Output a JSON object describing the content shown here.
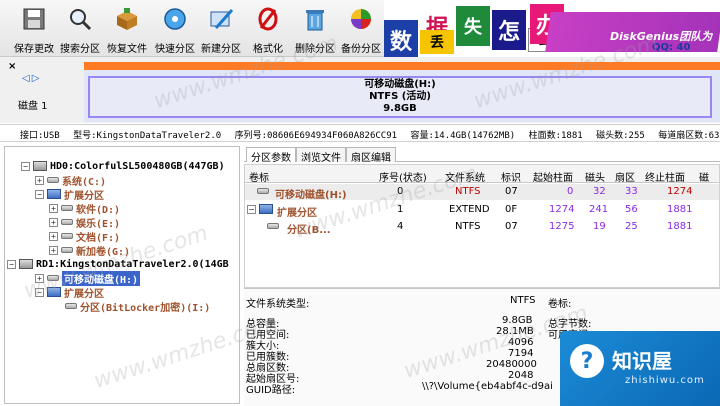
{
  "toolbar": {
    "buttons": [
      {
        "label": "保存更改",
        "icon": "save-icon"
      },
      {
        "label": "搜索分区",
        "icon": "magnifier-icon"
      },
      {
        "label": "恢复文件",
        "icon": "box-icon"
      },
      {
        "label": "快速分区",
        "icon": "quick-partition-icon"
      },
      {
        "label": "新建分区",
        "icon": "new-partition-icon"
      },
      {
        "label": "格式化",
        "icon": "format-icon"
      },
      {
        "label": "删除分区",
        "icon": "trash-icon"
      },
      {
        "label": "备份分区",
        "icon": "pie-backup-icon"
      }
    ]
  },
  "banner": {
    "tiles": [
      "数",
      "据",
      "丢",
      "失",
      "怎",
      "么",
      "办"
    ],
    "brand": "DiskGenius团队为",
    "qq": "QQ: 40"
  },
  "diskbar": {
    "close": "×",
    "arrows": "◁▷",
    "disk_label": "磁盘 1",
    "partition_name": "可移动磁盘(H:)",
    "partition_fs": "NTFS (活动)",
    "partition_size": "9.8GB"
  },
  "infoline": {
    "iface": "接口:USB",
    "model": "型号:KingstonDataTraveler2.0",
    "serial": "序列号:08606E694934F060A826CC91",
    "capacity": "容量:14.4GB(14762MB)",
    "cyl": "柱面数:1881",
    "heads": "磁头数:255",
    "sectors": "每道扇区数:63"
  },
  "tree": {
    "items": [
      {
        "toggle": "−",
        "icon": "hdd",
        "label": "HD0:ColorfulSL500480GB(447GB)",
        "style": "dark"
      },
      {
        "toggle": "+",
        "icon": "vol",
        "label": "系统(C:)",
        "style": "brown"
      },
      {
        "toggle": "−",
        "icon": "ext",
        "label": "扩展分区",
        "style": "brown"
      },
      {
        "toggle": "+",
        "icon": "vol",
        "label": "软件(D:)",
        "style": "brown"
      },
      {
        "toggle": "+",
        "icon": "vol",
        "label": "娱乐(E:)",
        "style": "brown"
      },
      {
        "toggle": "+",
        "icon": "vol",
        "label": "文档(F:)",
        "style": "brown"
      },
      {
        "toggle": "+",
        "icon": "vol",
        "label": "新加卷(G:)",
        "style": "brown"
      },
      {
        "toggle": "−",
        "icon": "hdd",
        "label": "RD1:KingstonDataTraveler2.0(14GB",
        "style": "dark"
      },
      {
        "toggle": "+",
        "icon": "vol",
        "label": "可移动磁盘(H:)",
        "style": "sel"
      },
      {
        "toggle": "−",
        "icon": "ext",
        "label": "扩展分区",
        "style": "brown"
      },
      {
        "toggle": "",
        "icon": "vol",
        "label": "分区(BitLocker加密)(I:)",
        "style": "brown"
      }
    ]
  },
  "tabs": [
    "分区参数",
    "浏览文件",
    "扇区编辑"
  ],
  "table": {
    "headers": [
      "卷标",
      "序号(状态)",
      "文件系统",
      "标识",
      "起始柱面",
      "磁头",
      "扇区",
      "终止柱面",
      "磁"
    ],
    "rows": [
      {
        "label": "可移动磁盘(H:)",
        "seq": "0",
        "fs": "NTFS",
        "id": "07",
        "start": "0",
        "head": "32",
        "sector": "33",
        "end": "1274"
      },
      {
        "label": "扩展分区",
        "seq": "1",
        "fs": "EXTEND",
        "id": "0F",
        "start": "1274",
        "head": "241",
        "sector": "56",
        "end": "1881"
      },
      {
        "label": "分区(B...",
        "seq": "4",
        "fs": "NTFS",
        "id": "07",
        "start": "1275",
        "head": "19",
        "sector": "25",
        "end": "1881"
      }
    ]
  },
  "details": {
    "fs_type_label": "文件系统类型:",
    "fs_type_value": "NTFS",
    "vol_label": "卷标:",
    "rows": [
      {
        "label": "总容量:",
        "value": "9.8GB"
      },
      {
        "label": "已用空间:",
        "value": "28.1MB"
      },
      {
        "label": "簇大小:",
        "value": "4096"
      },
      {
        "label": "已用簇数:",
        "value": "7194"
      },
      {
        "label": "总扇区数:",
        "value": "20480000"
      },
      {
        "label": "起始扇区号:",
        "value": "2048"
      },
      {
        "label": "GUID路径:",
        "value": "\\\\?\\Volume{eb4abf4c-d9ai"
      }
    ],
    "right_rows": [
      "总字节数:",
      "可用空间:"
    ]
  },
  "watermarks": [
    "www.wmzhe.com",
    "www.wmzhe.com",
    "www.wmzhe.com",
    "www.wmzhe.com",
    "www.wmzhe.com",
    "www.wmzhe.com"
  ],
  "logo": {
    "bulb": "?",
    "title": "知识屋",
    "sub": "zhishiwu.com"
  }
}
